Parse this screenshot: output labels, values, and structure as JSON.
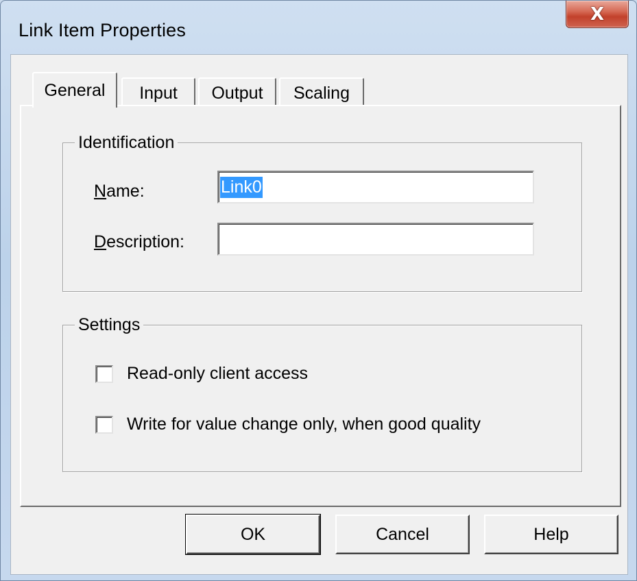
{
  "window": {
    "title": "Link Item Properties",
    "close_glyph": "X"
  },
  "tabs": [
    {
      "label": "General",
      "active": true
    },
    {
      "label": "Input",
      "active": false
    },
    {
      "label": "Output",
      "active": false
    },
    {
      "label": "Scaling",
      "active": false
    }
  ],
  "identification": {
    "legend": "Identification",
    "name_label_accel": "N",
    "name_label_rest": "ame:",
    "name_value": "Link0",
    "description_label_accel": "D",
    "description_label_rest": "escription:",
    "description_value": ""
  },
  "settings": {
    "legend": "Settings",
    "read_only_label": "Read-only client access",
    "read_only_checked": false,
    "write_change_label": "Write for value change only, when good quality",
    "write_change_checked": false
  },
  "buttons": {
    "ok": "OK",
    "cancel": "Cancel",
    "help": "Help"
  },
  "colors": {
    "selection": "#3399ff",
    "close_button": "#c2412b",
    "dialog_face": "#f0f0f0"
  }
}
